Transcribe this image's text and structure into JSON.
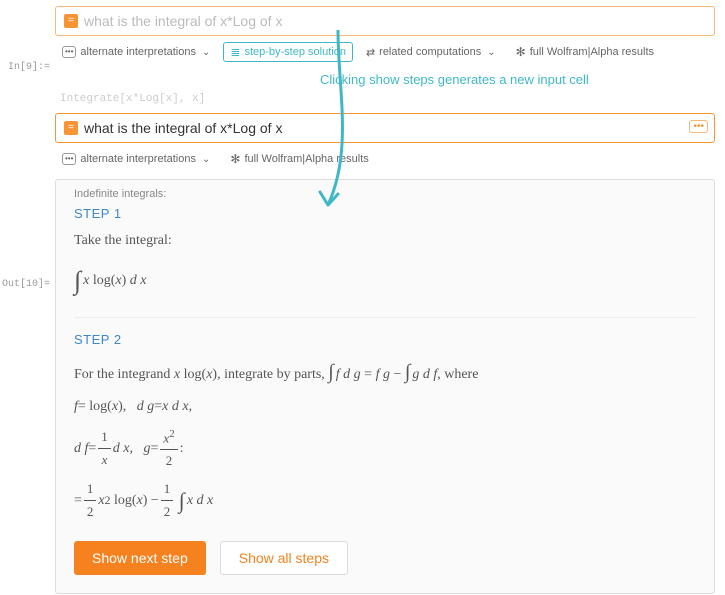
{
  "annotation": "Clicking show steps generates a new input cell",
  "faded_code": "Integrate[x*Log[x], x]",
  "prompt_in": "In[9]:=",
  "prompt_out": "Out[10]=",
  "input1": {
    "text": "what is the integral of x*Log of x"
  },
  "input2": {
    "text": "what is the integral of x*Log of x"
  },
  "toolbar": {
    "alt_interp": "alternate interpretations",
    "step_by_step": "step-by-step solution",
    "related": "related computations",
    "full_wolfram": "full Wolfram|Alpha results"
  },
  "result": {
    "section": "Indefinite integrals:",
    "step1_label": "STEP 1",
    "step1_text": "Take the integral:",
    "step2_label": "STEP 2",
    "step2_text_a": "For the integrand ",
    "step2_text_b": ", integrate by parts, ",
    "step2_text_c": ", where"
  },
  "buttons": {
    "next": "Show next step",
    "all": "Show all steps"
  }
}
